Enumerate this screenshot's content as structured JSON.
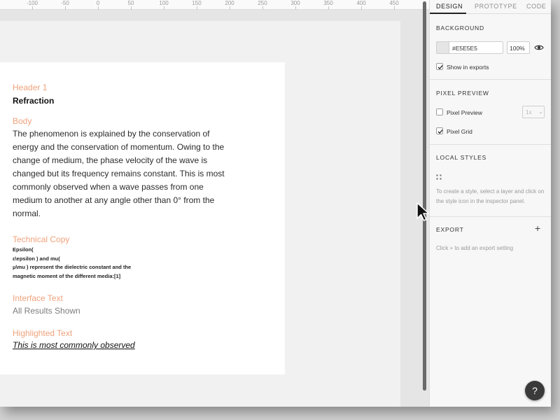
{
  "ruler": {
    "ticks": [
      "-100",
      "-50",
      "0",
      "50",
      "100",
      "150",
      "200",
      "250",
      "300",
      "350",
      "400",
      "450"
    ]
  },
  "artboard": {
    "header_label": "Header 1",
    "header_value": "Refraction",
    "body_label": "Body",
    "body_text": "The phenomenon is explained by the conservation of energy and the conservation of momentum. Owing to the change of medium, the phase velocity of the wave is changed but its frequency remains constant. This is most commonly observed when a wave passes from one medium to another at any angle other than 0° from the normal.",
    "technical_label": "Technical Copy",
    "technical_lines": [
      "Epsilon(",
      "ε\\epsilon ) and mu(",
      "μ\\mu ) represent the dielectric constant and the",
      "magnetic moment of the different media:[1]"
    ],
    "interface_label": "Interface Text",
    "interface_value": "All Results Shown",
    "highlighted_label": "Highlighted Text",
    "highlighted_value": "This is most commonly observed"
  },
  "panel": {
    "tabs": [
      "DESIGN",
      "PROTOTYPE",
      "CODE"
    ],
    "active_tab": "DESIGN",
    "background": {
      "title": "BACKGROUND",
      "color_hex": "#E5E5E5",
      "opacity": "100%",
      "show_in_exports_label": "Show in exports",
      "show_in_exports_checked": true
    },
    "pixel_preview": {
      "title": "PIXEL PREVIEW",
      "pixel_preview_label": "Pixel Preview",
      "pixel_preview_checked": false,
      "zoom_value": "1x",
      "pixel_grid_label": "Pixel Grid",
      "pixel_grid_checked": true
    },
    "local_styles": {
      "title": "LOCAL STYLES",
      "help": "To create a style, select a layer and click on the style icon in the inspector panel."
    },
    "export": {
      "title": "EXPORT",
      "help": "Click + to add an export setting",
      "add_symbol": "+"
    }
  },
  "help_button": "?",
  "colors": {
    "accent_label": "#EFA27C",
    "canvas": "#E5E5E5",
    "panel": "#F7F7F7"
  },
  "icons": [
    "eye-icon",
    "check-icon",
    "chevron-down-icon",
    "styles-dots-icon",
    "plus-icon",
    "cursor-icon"
  ]
}
